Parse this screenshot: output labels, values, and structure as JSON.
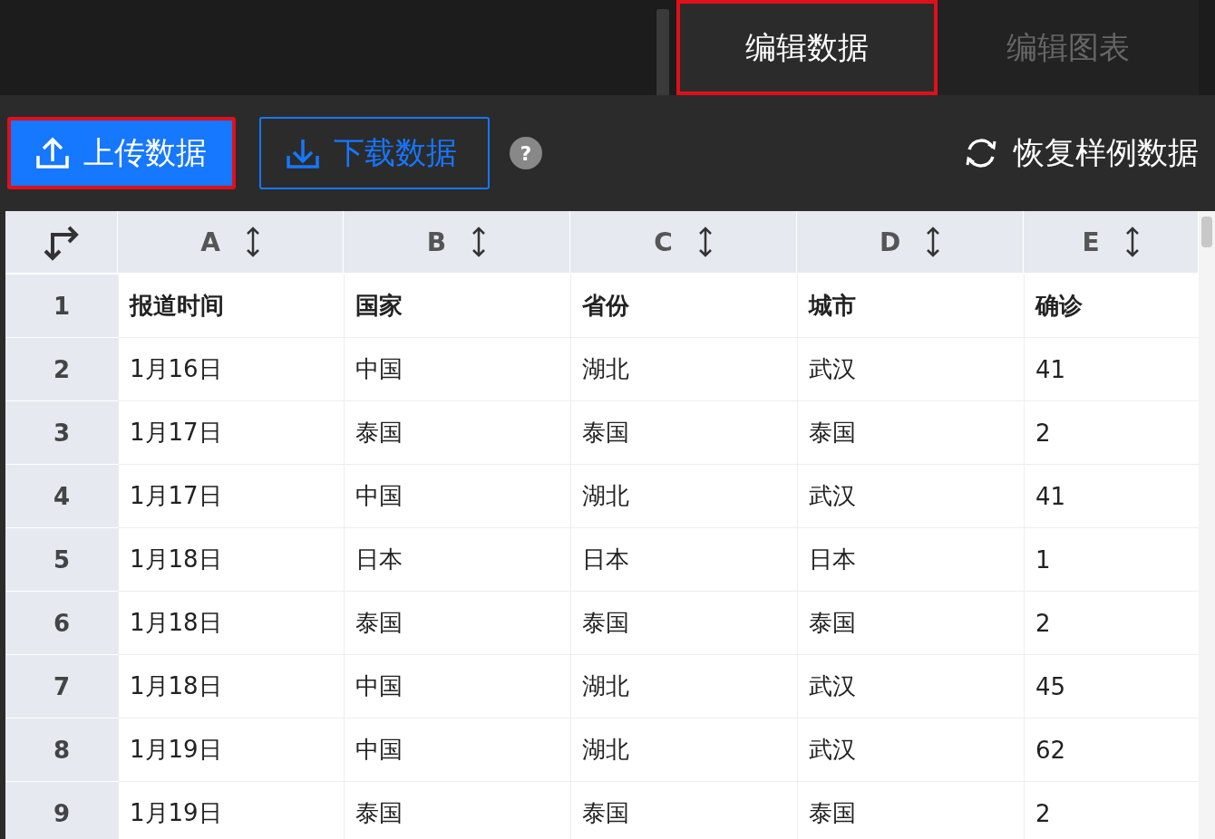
{
  "tabs": [
    {
      "label": "编辑数据",
      "selected": true,
      "highlighted": true
    },
    {
      "label": "编辑图表",
      "selected": false,
      "highlighted": false
    }
  ],
  "toolbar": {
    "upload": {
      "label": "上传数据",
      "highlighted": true
    },
    "download": {
      "label": "下载数据"
    },
    "help": "?",
    "restore": {
      "label": "恢复样例数据"
    }
  },
  "table": {
    "columns": [
      "A",
      "B",
      "C",
      "D",
      "E"
    ],
    "rows": [
      {
        "number": "1",
        "cells": [
          "报道时间",
          "国家",
          "省份",
          "城市",
          "确诊"
        ]
      },
      {
        "number": "2",
        "cells": [
          "1月16日",
          "中国",
          "湖北",
          "武汉",
          "41"
        ]
      },
      {
        "number": "3",
        "cells": [
          "1月17日",
          "泰国",
          "泰国",
          "泰国",
          "2"
        ]
      },
      {
        "number": "4",
        "cells": [
          "1月17日",
          "中国",
          "湖北",
          "武汉",
          "41"
        ]
      },
      {
        "number": "5",
        "cells": [
          "1月18日",
          "日本",
          "日本",
          "日本",
          "1"
        ]
      },
      {
        "number": "6",
        "cells": [
          "1月18日",
          "泰国",
          "泰国",
          "泰国",
          "2"
        ]
      },
      {
        "number": "7",
        "cells": [
          "1月18日",
          "中国",
          "湖北",
          "武汉",
          "45"
        ]
      },
      {
        "number": "8",
        "cells": [
          "1月19日",
          "中国",
          "湖北",
          "武汉",
          "62"
        ]
      },
      {
        "number": "9",
        "cells": [
          "1月19日",
          "泰国",
          "泰国",
          "泰国",
          "2"
        ]
      }
    ]
  }
}
